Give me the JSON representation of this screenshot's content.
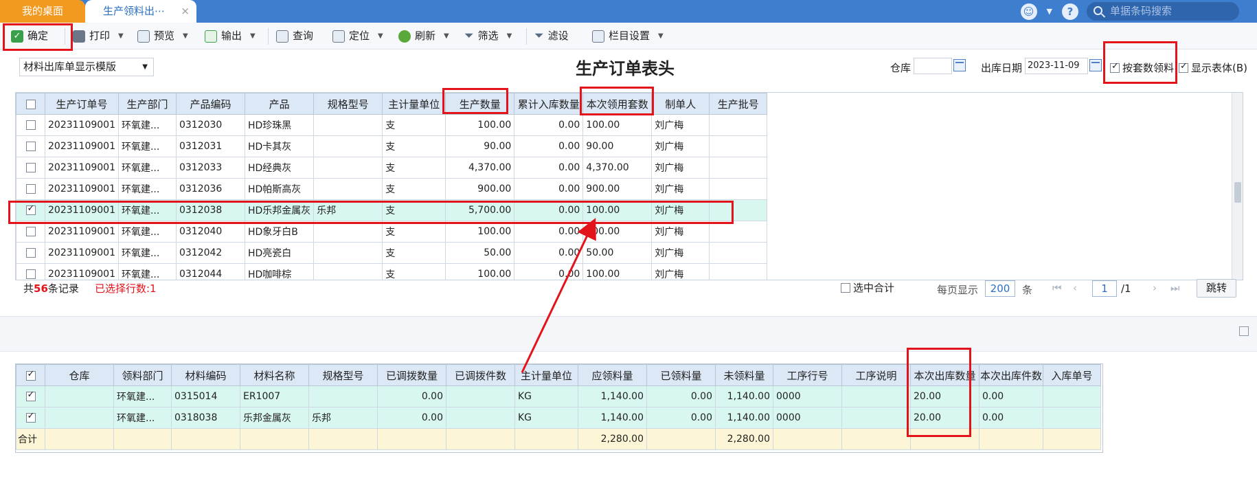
{
  "tabs": {
    "home": "我的桌面",
    "active": "生产领料出⋯",
    "close": "×"
  },
  "topbar": {
    "search_placeholder": "单据条码搜索",
    "help": "?"
  },
  "toolbar": {
    "confirm": "确定",
    "print": "打印",
    "preview": "预览",
    "export": "输出",
    "query": "查询",
    "locate": "定位",
    "refresh": "刷新",
    "filter": "筛选",
    "filter2": "滤设",
    "columns": "栏目设置"
  },
  "header": {
    "template": "材料出库单显示模版",
    "title": "生产订单表头",
    "warehouse_label": "仓库",
    "warehouse_value": "",
    "date_label": "出库日期",
    "date_value": "2023-11-09",
    "by_set_label": "按套数领料",
    "show_body_label": "显示表体(B)"
  },
  "top_table": {
    "columns": [
      "生产订单号",
      "生产部门",
      "产品编码",
      "产品",
      "规格型号",
      "主计量单位",
      "生产数量",
      "累计入库数量",
      "本次领用套数",
      "制单人",
      "生产批号"
    ],
    "rows": [
      {
        "checked": false,
        "cells": [
          "20231109001",
          "环氧建...",
          "0312030",
          "HD珍珠黑",
          "",
          "支",
          "100.00",
          "0.00",
          "100.00",
          "刘广梅",
          ""
        ]
      },
      {
        "checked": false,
        "cells": [
          "20231109001",
          "环氧建...",
          "0312031",
          "HD卡其灰",
          "",
          "支",
          "90.00",
          "0.00",
          "90.00",
          "刘广梅",
          ""
        ]
      },
      {
        "checked": false,
        "cells": [
          "20231109001",
          "环氧建...",
          "0312033",
          "HD经典灰",
          "",
          "支",
          "4,370.00",
          "0.00",
          "4,370.00",
          "刘广梅",
          ""
        ]
      },
      {
        "checked": false,
        "cells": [
          "20231109001",
          "环氧建...",
          "0312036",
          "HD帕斯高灰",
          "",
          "支",
          "900.00",
          "0.00",
          "900.00",
          "刘广梅",
          ""
        ]
      },
      {
        "checked": true,
        "cells": [
          "20231109001",
          "环氧建...",
          "0312038",
          "HD乐邦金属灰",
          "乐邦",
          "支",
          "5,700.00",
          "0.00",
          "100.00",
          "刘广梅",
          ""
        ]
      },
      {
        "checked": false,
        "cells": [
          "20231109001",
          "环氧建...",
          "0312040",
          "HD象牙白B",
          "",
          "支",
          "100.00",
          "0.00",
          "100.00",
          "刘广梅",
          ""
        ]
      },
      {
        "checked": false,
        "cells": [
          "20231109001",
          "环氧建...",
          "0312042",
          "HD亮瓷白",
          "",
          "支",
          "50.00",
          "0.00",
          "50.00",
          "刘广梅",
          ""
        ]
      },
      {
        "checked": false,
        "cells": [
          "20231109001",
          "环氧建...",
          "0312044",
          "HD咖啡棕",
          "",
          "支",
          "100.00",
          "0.00",
          "100.00",
          "刘广梅",
          ""
        ]
      }
    ]
  },
  "status": {
    "total_prefix": "共",
    "total_count": "56",
    "total_suffix": "条记录",
    "selected": "已选择行数:1",
    "sum_selected": "选中合计",
    "per_page_label": "每页显示",
    "per_page_value": "200",
    "per_page_unit": "条",
    "page_current": "1",
    "page_total": "/1",
    "jump": "跳转"
  },
  "bottom_table": {
    "columns": [
      "仓库",
      "领料部门",
      "材料编码",
      "材料名称",
      "规格型号",
      "已调拨数量",
      "已调拨件数",
      "主计量单位",
      "应领料量",
      "已领料量",
      "未领料量",
      "工序行号",
      "工序说明",
      "本次出库数量",
      "本次出库件数",
      "入库单号"
    ],
    "rows": [
      {
        "checked": true,
        "cells": [
          "",
          "环氧建...",
          "0315014",
          "ER1007",
          "",
          "0.00",
          "",
          "KG",
          "1,140.00",
          "0.00",
          "1,140.00",
          "0000",
          "",
          "20.00",
          "0.00",
          ""
        ]
      },
      {
        "checked": true,
        "cells": [
          "",
          "环氧建...",
          "0318038",
          "乐邦金属灰",
          "乐邦",
          "0.00",
          "",
          "KG",
          "1,140.00",
          "0.00",
          "1,140.00",
          "0000",
          "",
          "20.00",
          "0.00",
          ""
        ]
      }
    ],
    "sum_label": "合计",
    "sum_required": "2,280.00",
    "sum_remaining": "2,280.00"
  },
  "colors": {
    "topbar": "#3d7ecf",
    "home_tab": "#f29a1f",
    "selected_row": "#d9f7f1",
    "sum_row": "#fdf6d6",
    "annotation": "#e3131b"
  }
}
